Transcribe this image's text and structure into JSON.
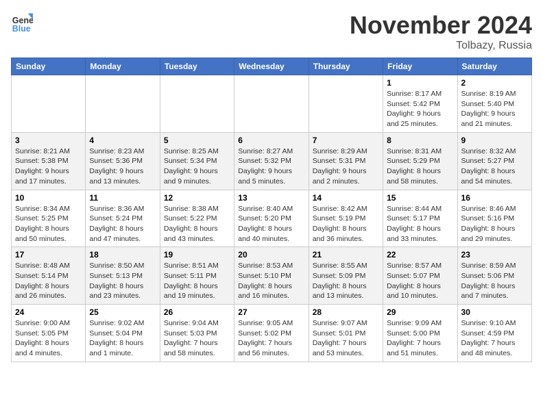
{
  "header": {
    "logo_line1": "General",
    "logo_line2": "Blue",
    "month": "November 2024",
    "location": "Tolbazy, Russia"
  },
  "days_of_week": [
    "Sunday",
    "Monday",
    "Tuesday",
    "Wednesday",
    "Thursday",
    "Friday",
    "Saturday"
  ],
  "weeks": [
    [
      {
        "day": "",
        "info": ""
      },
      {
        "day": "",
        "info": ""
      },
      {
        "day": "",
        "info": ""
      },
      {
        "day": "",
        "info": ""
      },
      {
        "day": "",
        "info": ""
      },
      {
        "day": "1",
        "info": "Sunrise: 8:17 AM\nSunset: 5:42 PM\nDaylight: 9 hours and 25 minutes."
      },
      {
        "day": "2",
        "info": "Sunrise: 8:19 AM\nSunset: 5:40 PM\nDaylight: 9 hours and 21 minutes."
      }
    ],
    [
      {
        "day": "3",
        "info": "Sunrise: 8:21 AM\nSunset: 5:38 PM\nDaylight: 9 hours and 17 minutes."
      },
      {
        "day": "4",
        "info": "Sunrise: 8:23 AM\nSunset: 5:36 PM\nDaylight: 9 hours and 13 minutes."
      },
      {
        "day": "5",
        "info": "Sunrise: 8:25 AM\nSunset: 5:34 PM\nDaylight: 9 hours and 9 minutes."
      },
      {
        "day": "6",
        "info": "Sunrise: 8:27 AM\nSunset: 5:32 PM\nDaylight: 9 hours and 5 minutes."
      },
      {
        "day": "7",
        "info": "Sunrise: 8:29 AM\nSunset: 5:31 PM\nDaylight: 9 hours and 2 minutes."
      },
      {
        "day": "8",
        "info": "Sunrise: 8:31 AM\nSunset: 5:29 PM\nDaylight: 8 hours and 58 minutes."
      },
      {
        "day": "9",
        "info": "Sunrise: 8:32 AM\nSunset: 5:27 PM\nDaylight: 8 hours and 54 minutes."
      }
    ],
    [
      {
        "day": "10",
        "info": "Sunrise: 8:34 AM\nSunset: 5:25 PM\nDaylight: 8 hours and 50 minutes."
      },
      {
        "day": "11",
        "info": "Sunrise: 8:36 AM\nSunset: 5:24 PM\nDaylight: 8 hours and 47 minutes."
      },
      {
        "day": "12",
        "info": "Sunrise: 8:38 AM\nSunset: 5:22 PM\nDaylight: 8 hours and 43 minutes."
      },
      {
        "day": "13",
        "info": "Sunrise: 8:40 AM\nSunset: 5:20 PM\nDaylight: 8 hours and 40 minutes."
      },
      {
        "day": "14",
        "info": "Sunrise: 8:42 AM\nSunset: 5:19 PM\nDaylight: 8 hours and 36 minutes."
      },
      {
        "day": "15",
        "info": "Sunrise: 8:44 AM\nSunset: 5:17 PM\nDaylight: 8 hours and 33 minutes."
      },
      {
        "day": "16",
        "info": "Sunrise: 8:46 AM\nSunset: 5:16 PM\nDaylight: 8 hours and 29 minutes."
      }
    ],
    [
      {
        "day": "17",
        "info": "Sunrise: 8:48 AM\nSunset: 5:14 PM\nDaylight: 8 hours and 26 minutes."
      },
      {
        "day": "18",
        "info": "Sunrise: 8:50 AM\nSunset: 5:13 PM\nDaylight: 8 hours and 23 minutes."
      },
      {
        "day": "19",
        "info": "Sunrise: 8:51 AM\nSunset: 5:11 PM\nDaylight: 8 hours and 19 minutes."
      },
      {
        "day": "20",
        "info": "Sunrise: 8:53 AM\nSunset: 5:10 PM\nDaylight: 8 hours and 16 minutes."
      },
      {
        "day": "21",
        "info": "Sunrise: 8:55 AM\nSunset: 5:09 PM\nDaylight: 8 hours and 13 minutes."
      },
      {
        "day": "22",
        "info": "Sunrise: 8:57 AM\nSunset: 5:07 PM\nDaylight: 8 hours and 10 minutes."
      },
      {
        "day": "23",
        "info": "Sunrise: 8:59 AM\nSunset: 5:06 PM\nDaylight: 8 hours and 7 minutes."
      }
    ],
    [
      {
        "day": "24",
        "info": "Sunrise: 9:00 AM\nSunset: 5:05 PM\nDaylight: 8 hours and 4 minutes."
      },
      {
        "day": "25",
        "info": "Sunrise: 9:02 AM\nSunset: 5:04 PM\nDaylight: 8 hours and 1 minute."
      },
      {
        "day": "26",
        "info": "Sunrise: 9:04 AM\nSunset: 5:03 PM\nDaylight: 7 hours and 58 minutes."
      },
      {
        "day": "27",
        "info": "Sunrise: 9:05 AM\nSunset: 5:02 PM\nDaylight: 7 hours and 56 minutes."
      },
      {
        "day": "28",
        "info": "Sunrise: 9:07 AM\nSunset: 5:01 PM\nDaylight: 7 hours and 53 minutes."
      },
      {
        "day": "29",
        "info": "Sunrise: 9:09 AM\nSunset: 5:00 PM\nDaylight: 7 hours and 51 minutes."
      },
      {
        "day": "30",
        "info": "Sunrise: 9:10 AM\nSunset: 4:59 PM\nDaylight: 7 hours and 48 minutes."
      }
    ]
  ]
}
